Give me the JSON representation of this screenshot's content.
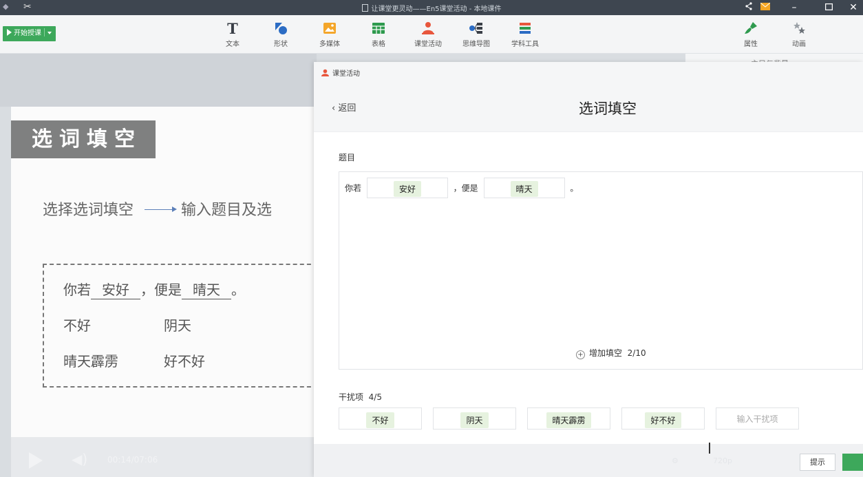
{
  "window": {
    "title": "让课堂更灵动——En5课堂活动 - 本地课件",
    "controls": [
      "share-icon",
      "mail-icon",
      "minimize-icon",
      "maximize-icon",
      "close-icon"
    ]
  },
  "toolbar": {
    "start_label": "开始授课",
    "tools": [
      {
        "label": "文本",
        "icon": "text-icon"
      },
      {
        "label": "形状",
        "icon": "shape-icon"
      },
      {
        "label": "多媒体",
        "icon": "media-icon"
      },
      {
        "label": "表格",
        "icon": "table-icon"
      },
      {
        "label": "课堂活动",
        "icon": "activity-icon"
      },
      {
        "label": "思维导图",
        "icon": "mindmap-icon"
      },
      {
        "label": "学科工具",
        "icon": "subject-tools-icon"
      }
    ],
    "right_tools": [
      {
        "label": "属性",
        "icon": "brush-icon"
      },
      {
        "label": "动画",
        "icon": "stars-icon"
      }
    ]
  },
  "right_strip": {
    "partial_text": "主目与背景"
  },
  "slide": {
    "title": "选词填空",
    "flow_left": "选择选词填空",
    "flow_right": "输入题目及选",
    "sentence": {
      "part1": "你若",
      "blank1": "安好",
      "part2": "，便是",
      "blank2": "晴天",
      "end": "。"
    },
    "options": [
      [
        "不好",
        "阴天"
      ],
      [
        "晴天霹雳",
        "好不好"
      ]
    ]
  },
  "player": {
    "time": "00:14/07:06"
  },
  "activity_panel": {
    "header_label": "课堂活动",
    "back_label": "返回",
    "heading": "选词填空",
    "question_label": "题目",
    "question": {
      "part1": "你若",
      "blank1": "安好",
      "part2": "，便是",
      "blank2": "晴天",
      "end": "。"
    },
    "add_blank_label": "增加填空",
    "add_blank_count": "2/10",
    "distractor_label": "干扰项",
    "distractor_count": "4/5",
    "distractors": [
      "不好",
      "阴天",
      "晴天霹雳",
      "好不好"
    ],
    "distractor_placeholder": "输入干扰项",
    "hint_label": "提示",
    "faint_text": "720p"
  },
  "colors": {
    "accent_green": "#3da85b",
    "chip_bg": "#e6f2df",
    "titlebar": "#3e4650"
  }
}
